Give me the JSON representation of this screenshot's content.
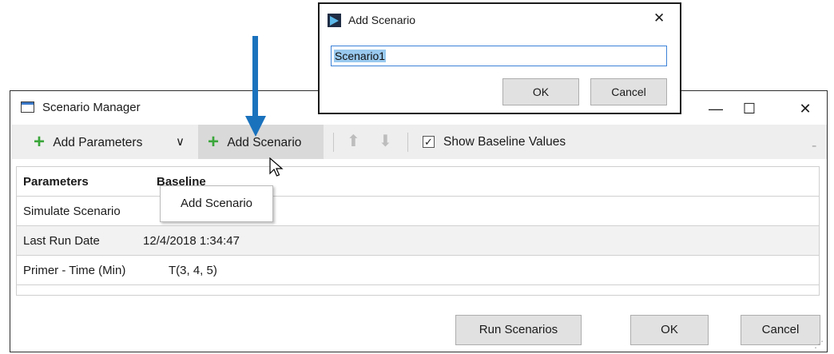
{
  "manager": {
    "title": "Scenario Manager",
    "window_controls": {
      "minimize": "—",
      "maximize": "☐",
      "close": "✕"
    },
    "toolbar": {
      "add_parameters": "Add Parameters",
      "dropdown_glyph": "∨",
      "add_scenario": "Add Scenario",
      "move_up": "⬆",
      "move_down": "⬇",
      "show_baseline_checked": true,
      "show_baseline_label": "Show Baseline Values",
      "overflow_glyph": "₌"
    },
    "grid": {
      "headers": {
        "parameters": "Parameters",
        "baseline": "Baseline"
      },
      "rows": [
        {
          "name": "Simulate Scenario",
          "value": ""
        },
        {
          "name": "Last Run Date",
          "value": "12/4/2018 1:34:47"
        },
        {
          "name": "Primer - Time (Min)",
          "value": "T(3, 4, 5)"
        }
      ]
    },
    "buttons": {
      "run": "Run Scenarios",
      "ok": "OK",
      "cancel": "Cancel"
    }
  },
  "tooltip": {
    "text": "Add Scenario"
  },
  "dialog": {
    "title": "Add Scenario",
    "close_glyph": "✕",
    "input_value": "Scenario1",
    "ok": "OK",
    "cancel": "Cancel"
  },
  "colors": {
    "accent_arrow": "#1a72bd",
    "plus_green": "#3aa63a",
    "selection": "#99c9ef"
  }
}
